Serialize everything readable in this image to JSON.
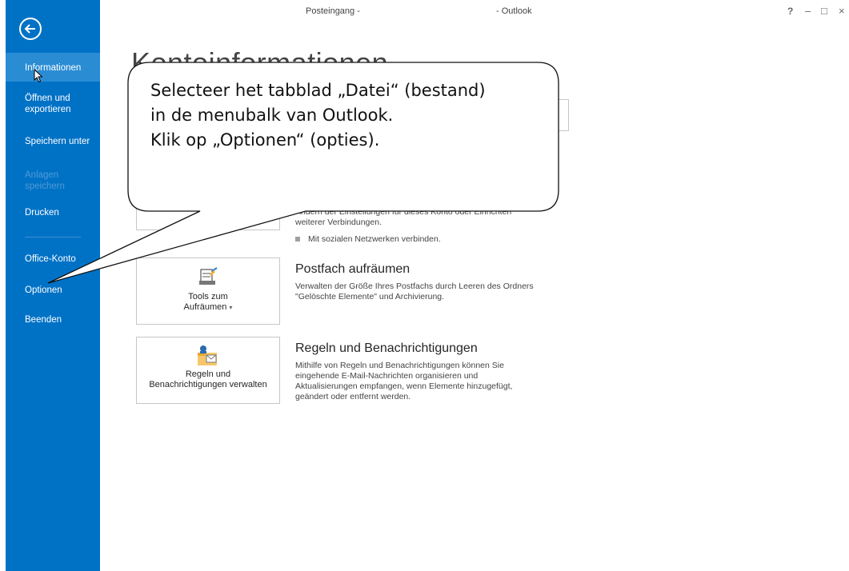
{
  "titlebar": {
    "left": "Posteingang -",
    "right": "- Outlook",
    "help": "?",
    "minimize": "–",
    "maximize": "□",
    "close": "×"
  },
  "sidebar": {
    "back_icon": "back-arrow-icon",
    "items": [
      {
        "label": "Informationen",
        "state": "active"
      },
      {
        "label": "Öffnen und exportieren",
        "state": "normal"
      },
      {
        "label": "Speichern unter",
        "state": "normal"
      },
      {
        "label": "Anlagen speichern",
        "state": "disabled"
      },
      {
        "label": "Drucken",
        "state": "normal"
      },
      {
        "label": "Office-Konto",
        "state": "normal"
      },
      {
        "label": "Optionen",
        "state": "normal"
      },
      {
        "label": "Beenden",
        "state": "normal"
      }
    ],
    "colors": {
      "background": "#0072c6",
      "active": "#2a8dd4"
    }
  },
  "main": {
    "page_title": "Kontoinformationen",
    "account_settings": {
      "text_line1": "Ändern der Einstellungen für dieses Konto oder Einrichten",
      "text_line2": "weiterer Verbindungen.",
      "bullet": "Mit sozialen Netzwerken verbinden."
    },
    "cleanup": {
      "button_line1": "Tools zum",
      "button_line2": "Aufräumen",
      "dropdown_glyph": "▾",
      "title": "Postfach aufräumen",
      "text_line1": "Verwalten der Größe Ihres Postfachs durch Leeren des Ordners",
      "text_line2": "\"Gelöschte Elemente\" und Archivierung.",
      "icon": "mailbox-cleanup-icon"
    },
    "rules": {
      "button_line1": "Regeln und",
      "button_line2": "Benachrichtigungen verwalten",
      "title": "Regeln und Benachrichtigungen",
      "text_line1": "Mithilfe von Regeln und Benachrichtigungen können Sie",
      "text_line2": "eingehende E-Mail-Nachrichten organisieren und",
      "text_line3": "Aktualisierungen empfangen, wenn Elemente hinzugefügt,",
      "text_line4": "geändert oder entfernt werden.",
      "icon": "rules-alerts-icon"
    }
  },
  "callout": {
    "line1": "Selecteer het tabblad „Datei“ (bestand)",
    "line2": "in de menubalk van Outlook.",
    "line3": "Klik op „Optionen“ (opties)."
  }
}
